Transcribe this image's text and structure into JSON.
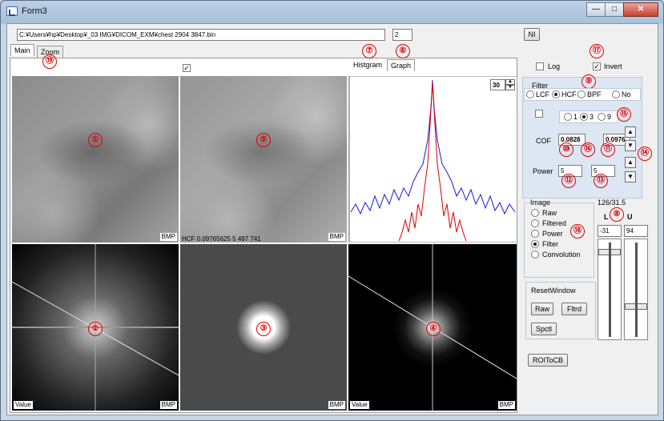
{
  "window": {
    "title": "Form3",
    "minimize": "—",
    "maximize": "□",
    "close": "✕"
  },
  "toolbar": {
    "path_value": "C:¥Users¥hp¥Desktop¥_03 IMG¥DICOM_EXM¥chest 2904 3847.bin",
    "number_value": "2",
    "ni_label": "NI"
  },
  "tabs": {
    "main": "Main",
    "zoom": "Zoom",
    "histogram": "Histgram",
    "graph": "Graph"
  },
  "image_tags": {
    "bmp": "BMP",
    "value": "Value",
    "hcf_info": "HCF 0.09765625 5 497 741"
  },
  "graph": {
    "spin_value": "30",
    "spin_up": "▲",
    "spin_down": "▼"
  },
  "options": {
    "log_label": "Log",
    "invert_label": "Invert",
    "invert_checked": "✓",
    "top_check": "✓"
  },
  "filter": {
    "group_label": "Filter",
    "lcf": "LCF",
    "hcf": "HCF",
    "bpf": "BPF",
    "no": "No",
    "n1": "1",
    "n3": "3",
    "n9": "9",
    "cof_label": "COF",
    "cof_value_1": "0.0828",
    "cof_value_2": "0.0976",
    "power_label": "Power",
    "power_value_1": "5",
    "power_value_2": "5",
    "up_arrow": "▲",
    "down_arrow": "▼"
  },
  "image_group": {
    "label": "Image",
    "raw": "Raw",
    "filtered": "Filtered",
    "power": "Power",
    "filter": "Filter",
    "convolution": "Convolution"
  },
  "window_range": {
    "ratio": "126/31.5",
    "l_label": "L",
    "u_label": "U",
    "l_value": "-31",
    "u_value": "94"
  },
  "reset": {
    "label": "ResetWindow",
    "raw": "Raw",
    "fltrd": "Fltrd",
    "spctl": "Spctl",
    "roi": "ROIToCB"
  },
  "markers": [
    "①",
    "②",
    "③",
    "④",
    "⑤",
    "⑥",
    "⑦",
    "⑧",
    "⑨",
    "⑩",
    "⑪",
    "⑫",
    "⑬",
    "⑭",
    "⑮",
    "⑯",
    "⑰",
    "⑱",
    "⑲"
  ],
  "colors": {
    "red_series": "#e00000",
    "blue_series": "#1a1adc",
    "marker": "#e00000"
  }
}
